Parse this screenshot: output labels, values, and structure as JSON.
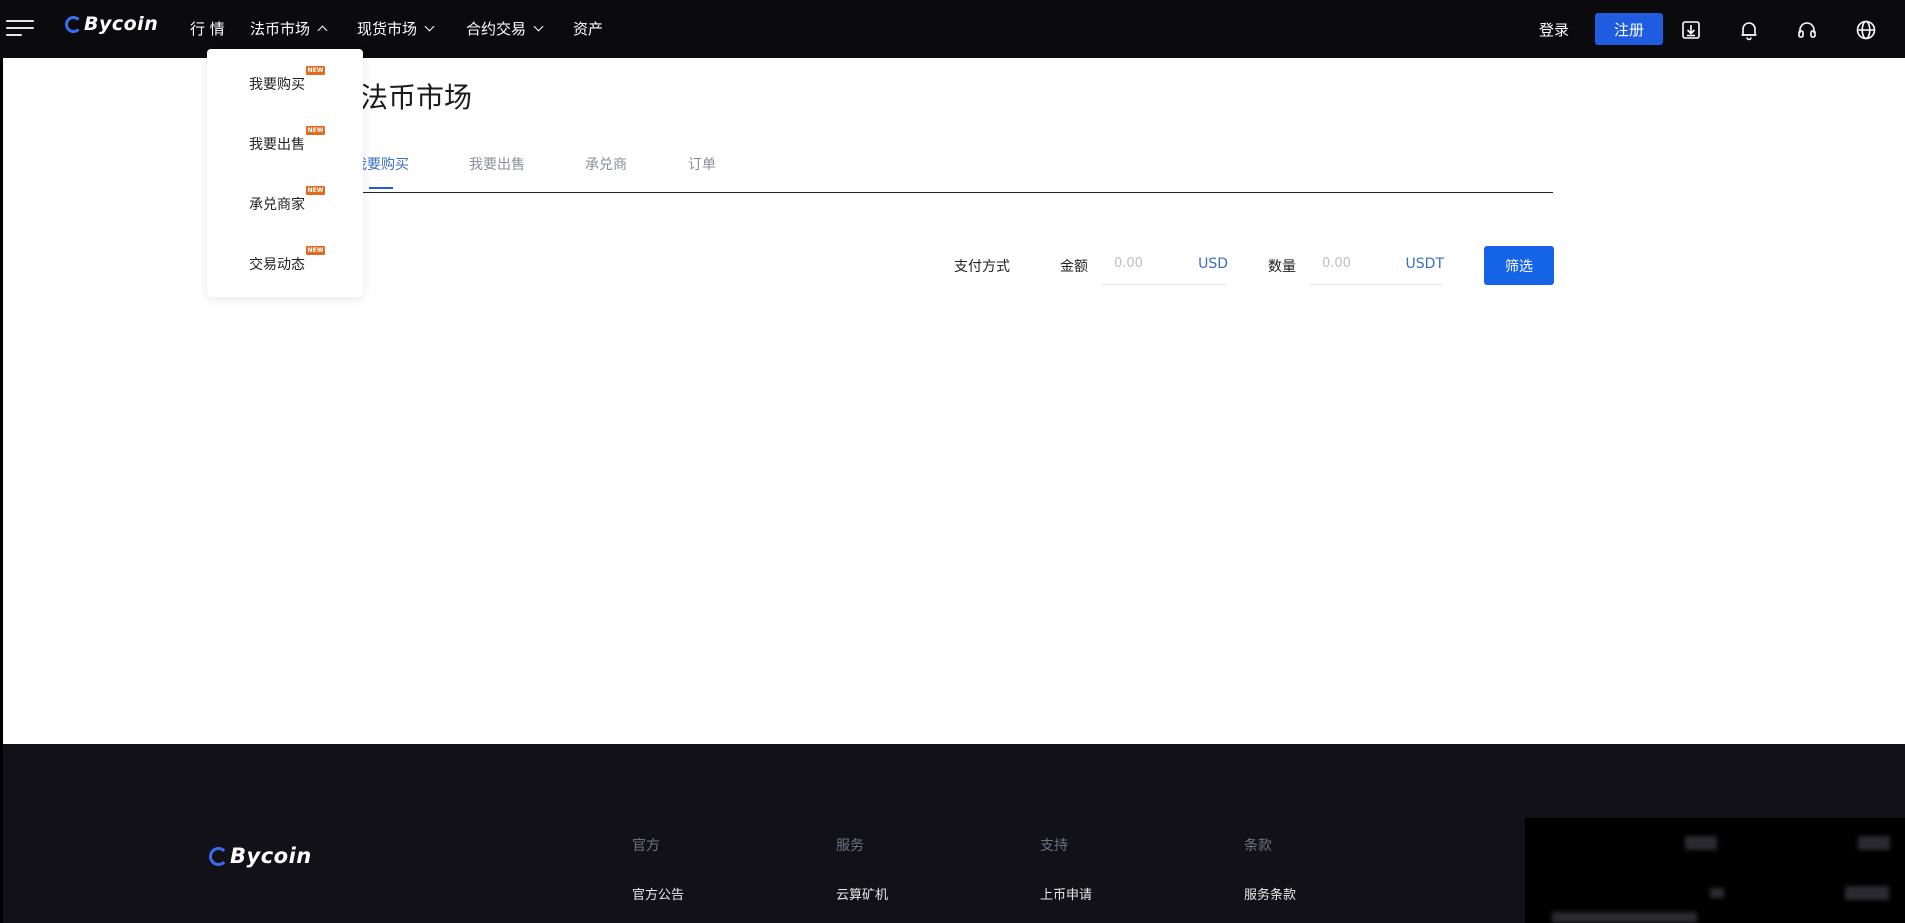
{
  "brand": {
    "name": "Bycoin"
  },
  "nav": {
    "items": [
      {
        "label": "行 情",
        "chevron": ""
      },
      {
        "label": "法币市场",
        "chevron": "up"
      },
      {
        "label": "现货市场",
        "chevron": "down"
      },
      {
        "label": "合约交易",
        "chevron": "down"
      },
      {
        "label": "资产",
        "chevron": ""
      }
    ],
    "login": "登录",
    "register": "注册",
    "icons": [
      "download-icon",
      "bell-icon",
      "headset-icon",
      "globe-icon"
    ]
  },
  "dropdown": {
    "items": [
      {
        "label": "我要购买",
        "badge": "NEW"
      },
      {
        "label": "我要出售",
        "badge": "NEW"
      },
      {
        "label": "承兑商家",
        "badge": "NEW"
      },
      {
        "label": "交易动态",
        "badge": "NEW"
      }
    ]
  },
  "page": {
    "title": "法币市场",
    "tabs": [
      {
        "label": "我要购买",
        "active": true
      },
      {
        "label": "我要出售",
        "active": false
      },
      {
        "label": "承兑商",
        "active": false
      },
      {
        "label": "订单",
        "active": false
      }
    ],
    "filters": {
      "payment_label": "支付方式",
      "amount_label": "金额",
      "amount_placeholder": "0.00",
      "amount_unit": "USD",
      "quantity_label": "数量",
      "quantity_placeholder": "0.00",
      "quantity_unit": "USDT",
      "filter_button": "筛选"
    }
  },
  "footer": {
    "columns": [
      {
        "heading": "官方",
        "link": "官方公告"
      },
      {
        "heading": "服务",
        "link": "云算矿机"
      },
      {
        "heading": "支持",
        "link": "上币申请"
      },
      {
        "heading": "条款",
        "link": "服务条款"
      }
    ]
  },
  "colors": {
    "accent": "#1f5ce0",
    "topbar_bg": "#0b0b0e",
    "footer_bg": "#111117",
    "badge": "#e06a1f",
    "link_blue": "#3a6fc4"
  }
}
